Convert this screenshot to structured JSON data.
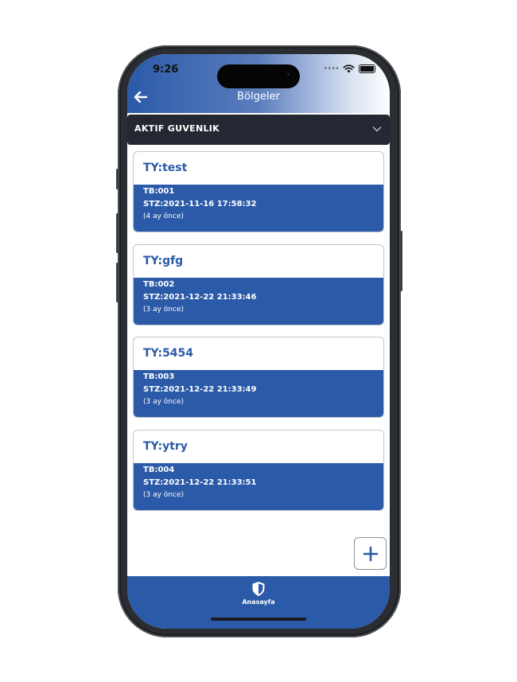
{
  "status_bar": {
    "time": "9:26"
  },
  "header": {
    "title": "Bölgeler"
  },
  "dropdown": {
    "selected": "AKTIF GUVENLIK"
  },
  "cards": [
    {
      "title": "TY:test",
      "tb": "TB:001",
      "stz": "STZ:2021-11-16 17:58:32",
      "ago": "(4 ay önce)"
    },
    {
      "title": "TY:gfg",
      "tb": "TB:002",
      "stz": "STZ:2021-12-22 21:33:46",
      "ago": "(3 ay önce)"
    },
    {
      "title": "TY:5454",
      "tb": "TB:003",
      "stz": "STZ:2021-12-22 21:33:49",
      "ago": "(3 ay önce)"
    },
    {
      "title": "TY:ytry",
      "tb": "TB:004",
      "stz": "STZ:2021-12-22 21:33:51",
      "ago": "(3 ay önce)"
    }
  ],
  "bottom_nav": {
    "label": "Anasayfa",
    "icon": "shield-icon"
  },
  "colors": {
    "primary": "#2b5aa8",
    "dropdown_bg": "#232833"
  }
}
